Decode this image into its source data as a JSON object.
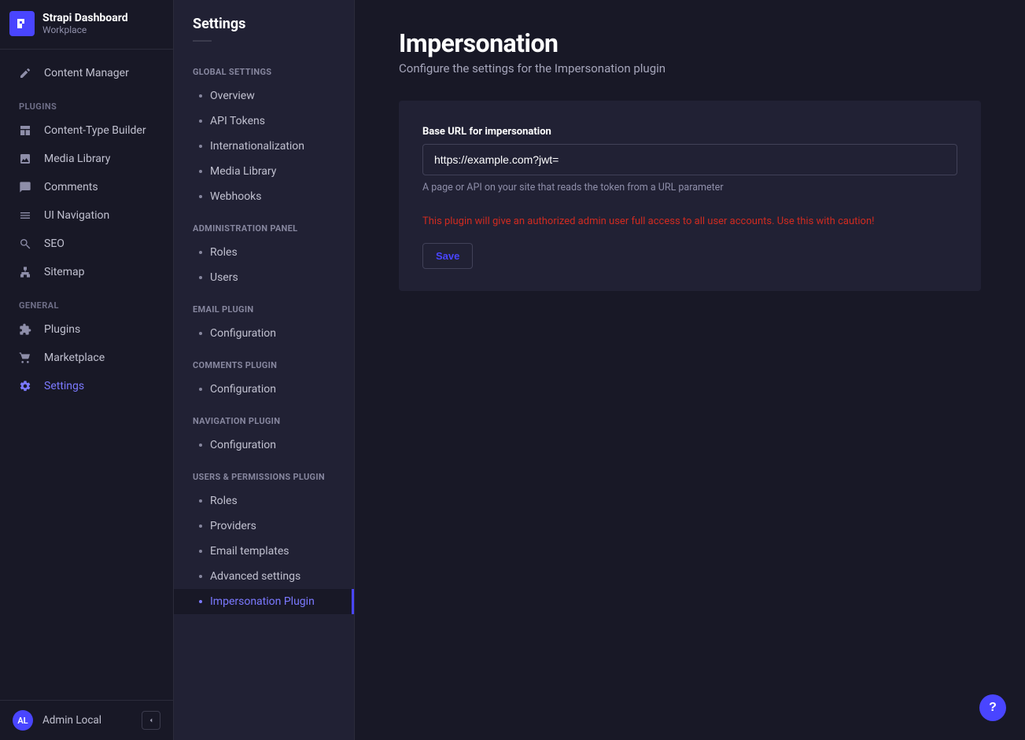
{
  "brand": {
    "title": "Strapi Dashboard",
    "subtitle": "Workplace"
  },
  "primaryNav": {
    "top": [
      {
        "id": "content-manager",
        "label": "Content Manager",
        "icon": "pencil"
      }
    ],
    "pluginsLabel": "Plugins",
    "plugins": [
      {
        "id": "content-type-builder",
        "label": "Content-Type Builder",
        "icon": "layout"
      },
      {
        "id": "media-library",
        "label": "Media Library",
        "icon": "image"
      },
      {
        "id": "comments",
        "label": "Comments",
        "icon": "comments"
      },
      {
        "id": "ui-navigation",
        "label": "UI Navigation",
        "icon": "bars"
      },
      {
        "id": "seo",
        "label": "SEO",
        "icon": "search"
      },
      {
        "id": "sitemap",
        "label": "Sitemap",
        "icon": "sitemap"
      }
    ],
    "generalLabel": "General",
    "general": [
      {
        "id": "plugins",
        "label": "Plugins",
        "icon": "puzzle"
      },
      {
        "id": "marketplace",
        "label": "Marketplace",
        "icon": "cart"
      },
      {
        "id": "settings",
        "label": "Settings",
        "icon": "gear",
        "active": true
      }
    ]
  },
  "footer": {
    "initials": "AL",
    "userName": "Admin Local"
  },
  "settingsNav": {
    "title": "Settings",
    "sections": [
      {
        "label": "Global Settings",
        "items": [
          {
            "id": "overview",
            "label": "Overview"
          },
          {
            "id": "api-tokens",
            "label": "API Tokens"
          },
          {
            "id": "internationalization",
            "label": "Internationalization"
          },
          {
            "id": "media-library",
            "label": "Media Library"
          },
          {
            "id": "webhooks",
            "label": "Webhooks"
          }
        ]
      },
      {
        "label": "Administration Panel",
        "items": [
          {
            "id": "roles",
            "label": "Roles"
          },
          {
            "id": "users",
            "label": "Users"
          }
        ]
      },
      {
        "label": "Email Plugin",
        "items": [
          {
            "id": "email-config",
            "label": "Configuration"
          }
        ]
      },
      {
        "label": "Comments Plugin",
        "items": [
          {
            "id": "comments-config",
            "label": "Configuration"
          }
        ]
      },
      {
        "label": "Navigation Plugin",
        "items": [
          {
            "id": "navigation-config",
            "label": "Configuration"
          }
        ]
      },
      {
        "label": "Users & Permissions Plugin",
        "items": [
          {
            "id": "up-roles",
            "label": "Roles"
          },
          {
            "id": "up-providers",
            "label": "Providers"
          },
          {
            "id": "up-email-templates",
            "label": "Email templates"
          },
          {
            "id": "up-advanced",
            "label": "Advanced settings"
          },
          {
            "id": "up-impersonation",
            "label": "Impersonation Plugin",
            "active": true
          }
        ]
      }
    ]
  },
  "page": {
    "title": "Impersonation",
    "subtitle": "Configure the settings for the Impersonation plugin",
    "fieldLabel": "Base URL for impersonation",
    "fieldValue": "https://example.com?jwt=",
    "fieldHelp": "A page or API on your site that reads the token from a URL parameter",
    "warning": "This plugin will give an authorized admin user full access to all user accounts. Use this with caution!",
    "saveLabel": "Save"
  },
  "helpFab": "?"
}
